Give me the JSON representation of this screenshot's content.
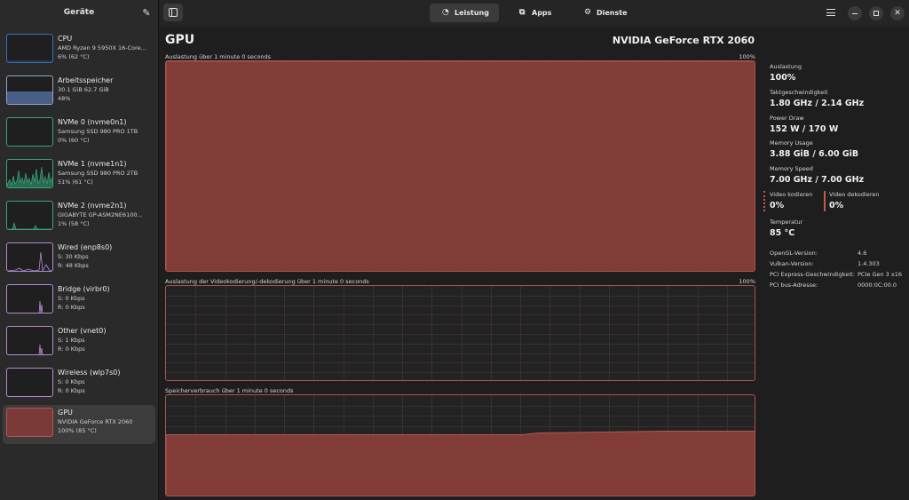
{
  "sidebar": {
    "title": "Geräte",
    "devices": [
      {
        "name": "CPU",
        "line1": "AMD Ryzen 9 5950X 16-Core...",
        "line2": "6% (62 °C)",
        "color": "#3a6fc2",
        "fill": "#27364f"
      },
      {
        "name": "Arbeitsspeicher",
        "line1": "30.1 GiB 62.7 GiB",
        "line2": "48%",
        "color": "#8fa4c9",
        "fill": "#4a5f86"
      },
      {
        "name": "NVMe 0 (nvme0n1)",
        "line1": "Samsung SSD 980 PRO 1TB",
        "line2": "0% (60 °C)",
        "color": "#3ba37a",
        "fill": "#1f3a2e"
      },
      {
        "name": "NVMe 1 (nvme1n1)",
        "line1": "Samsung SSD 980 PRO 2TB",
        "line2": "51% (61 °C)",
        "color": "#3ba37a",
        "fill": "#2b6b4f"
      },
      {
        "name": "NVMe 2 (nvme2n1)",
        "line1": "GIGABYTE GP-ASM2NE6100...",
        "line2": "1% (58 °C)",
        "color": "#3ba37a",
        "fill": "#1f3a2e"
      },
      {
        "name": "Wired (enp8s0)",
        "line1": "S: 30 Kbps",
        "line2": "R: 48 Kbps",
        "color": "#b38ad6",
        "fill": "#3a2b46"
      },
      {
        "name": "Bridge (virbr0)",
        "line1": "S: 0 Kbps",
        "line2": "R: 0 Kbps",
        "color": "#b38ad6",
        "fill": "#3a2b46"
      },
      {
        "name": "Other (vnet0)",
        "line1": "S: 1 Kbps",
        "line2": "R: 0 Kbps",
        "color": "#b38ad6",
        "fill": "#3a2b46"
      },
      {
        "name": "Wireless (wlp7s0)",
        "line1": "S: 0 Kbps",
        "line2": "R: 0 Kbps",
        "color": "#b38ad6",
        "fill": "#3a2b46"
      },
      {
        "name": "GPU",
        "line1": "NVIDIA GeForce RTX 2060",
        "line2": "100% (85 °C)",
        "color": "#b05550",
        "fill": "#7a3a38"
      }
    ]
  },
  "header": {
    "tabs": [
      {
        "label": "Leistung",
        "icon": "gauge-icon"
      },
      {
        "label": "Apps",
        "icon": "apps-icon"
      },
      {
        "label": "Dienste",
        "icon": "gear-icon"
      }
    ]
  },
  "main": {
    "title": "GPU",
    "model": "NVIDIA GeForce RTX 2060",
    "graphs": [
      {
        "label": "Auslastung über 1 minute 0 seconds",
        "max": "100%",
        "level": 1.0
      },
      {
        "label": "Auslastung der Videokodierung/-dekodierung über 1 minute 0 seconds",
        "max": "100%",
        "level": 0.0
      },
      {
        "label": "Speicherverbrauch über 1 minute 0 seconds",
        "max": "",
        "level": 0.63
      }
    ],
    "accent_color": "#8a3f3b"
  },
  "stats": {
    "usage": {
      "label": "Auslastung",
      "value": "100%"
    },
    "clock": {
      "label": "Taktgeschwindigkeit",
      "value": "1.80 GHz / 2.14 GHz"
    },
    "power": {
      "label": "Power Draw",
      "value": "152 W / 170 W"
    },
    "memory": {
      "label": "Memory Usage",
      "value": "3.88 GiB / 6.00 GiB"
    },
    "memspeed": {
      "label": "Memory Speed",
      "value": "7.00 GHz / 7.00 GHz"
    },
    "encode": {
      "label": "Video kodieren",
      "value": "0%"
    },
    "decode": {
      "label": "Video dekodieren",
      "value": "0%"
    },
    "temp": {
      "label": "Temperatur",
      "value": "85 °C"
    }
  },
  "info": [
    {
      "key": "OpenGL-Version:",
      "value": "4.6"
    },
    {
      "key": "Vulkan-Version:",
      "value": "1.4.303"
    },
    {
      "key": "PCI Express-Geschwindigkeit:",
      "value": "PCIe Gen 3 x16"
    },
    {
      "key": "PCI bus-Adresse:",
      "value": "0000:0C:00.0"
    }
  ]
}
